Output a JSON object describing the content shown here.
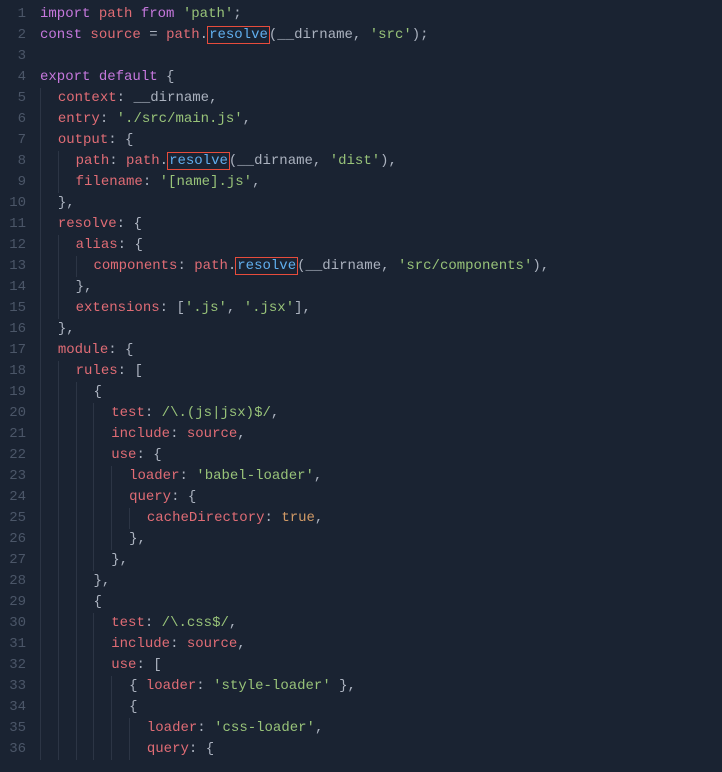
{
  "lines": [
    {
      "num": "1",
      "tokens": [
        [
          "kw",
          "import"
        ],
        [
          " "
        ],
        [
          "id",
          "path"
        ],
        [
          " "
        ],
        [
          "kw",
          "from"
        ],
        [
          " "
        ],
        [
          "str",
          "'path'"
        ],
        [
          "punc",
          ";"
        ]
      ]
    },
    {
      "num": "2",
      "tokens": [
        [
          "kw",
          "const"
        ],
        [
          " "
        ],
        [
          "id",
          "source"
        ],
        [
          " "
        ],
        [
          "punc",
          "="
        ],
        [
          " "
        ],
        [
          "id",
          "path"
        ],
        [
          "punc",
          "."
        ],
        [
          "fn hl",
          "resolve"
        ],
        [
          "punc",
          "("
        ],
        [
          "param",
          "__dirname"
        ],
        [
          "punc",
          ","
        ],
        [
          " "
        ],
        [
          "str",
          "'src'"
        ],
        [
          "punc",
          ");"
        ]
      ]
    },
    {
      "num": "3",
      "tokens": []
    },
    {
      "num": "4",
      "tokens": [
        [
          "kw",
          "export"
        ],
        [
          " "
        ],
        [
          "kw",
          "default"
        ],
        [
          " "
        ],
        [
          "punc",
          "{"
        ]
      ]
    },
    {
      "num": "5",
      "tokens": [
        [
          "",
          "  "
        ],
        [
          "prop",
          "context"
        ],
        [
          "punc",
          ":"
        ],
        [
          " "
        ],
        [
          "param",
          "__dirname"
        ],
        [
          "punc",
          ","
        ]
      ]
    },
    {
      "num": "6",
      "tokens": [
        [
          "",
          "  "
        ],
        [
          "prop",
          "entry"
        ],
        [
          "punc",
          ":"
        ],
        [
          " "
        ],
        [
          "str",
          "'./src/main.js'"
        ],
        [
          "punc",
          ","
        ]
      ]
    },
    {
      "num": "7",
      "tokens": [
        [
          "",
          "  "
        ],
        [
          "prop",
          "output"
        ],
        [
          "punc",
          ":"
        ],
        [
          " "
        ],
        [
          "punc",
          "{"
        ]
      ]
    },
    {
      "num": "8",
      "tokens": [
        [
          "",
          "    "
        ],
        [
          "prop",
          "path"
        ],
        [
          "punc",
          ":"
        ],
        [
          " "
        ],
        [
          "id",
          "path"
        ],
        [
          "punc",
          "."
        ],
        [
          "fn hl",
          "resolve"
        ],
        [
          "punc",
          "("
        ],
        [
          "param",
          "__dirname"
        ],
        [
          "punc",
          ","
        ],
        [
          " "
        ],
        [
          "str",
          "'dist'"
        ],
        [
          "punc",
          "),"
        ]
      ]
    },
    {
      "num": "9",
      "tokens": [
        [
          "",
          "    "
        ],
        [
          "prop",
          "filename"
        ],
        [
          "punc",
          ":"
        ],
        [
          " "
        ],
        [
          "str",
          "'[name].js'"
        ],
        [
          "punc",
          ","
        ]
      ]
    },
    {
      "num": "10",
      "tokens": [
        [
          "",
          "  "
        ],
        [
          "punc",
          "},"
        ]
      ]
    },
    {
      "num": "11",
      "tokens": [
        [
          "",
          "  "
        ],
        [
          "prop",
          "resolve"
        ],
        [
          "punc",
          ":"
        ],
        [
          " "
        ],
        [
          "punc",
          "{"
        ]
      ]
    },
    {
      "num": "12",
      "tokens": [
        [
          "",
          "    "
        ],
        [
          "prop",
          "alias"
        ],
        [
          "punc",
          ":"
        ],
        [
          " "
        ],
        [
          "punc",
          "{"
        ]
      ]
    },
    {
      "num": "13",
      "tokens": [
        [
          "",
          "      "
        ],
        [
          "prop",
          "components"
        ],
        [
          "punc",
          ":"
        ],
        [
          " "
        ],
        [
          "id",
          "path"
        ],
        [
          "punc",
          "."
        ],
        [
          "fn hl",
          "resolve"
        ],
        [
          "punc",
          "("
        ],
        [
          "param",
          "__dirname"
        ],
        [
          "punc",
          ","
        ],
        [
          " "
        ],
        [
          "str",
          "'src/components'"
        ],
        [
          "punc",
          "),"
        ]
      ]
    },
    {
      "num": "14",
      "tokens": [
        [
          "",
          "    "
        ],
        [
          "punc",
          "},"
        ]
      ]
    },
    {
      "num": "15",
      "tokens": [
        [
          "",
          "    "
        ],
        [
          "prop",
          "extensions"
        ],
        [
          "punc",
          ":"
        ],
        [
          " "
        ],
        [
          "punc",
          "["
        ],
        [
          "str",
          "'.js'"
        ],
        [
          "punc",
          ","
        ],
        [
          " "
        ],
        [
          "str",
          "'.jsx'"
        ],
        [
          "punc",
          "],"
        ]
      ]
    },
    {
      "num": "16",
      "tokens": [
        [
          "",
          "  "
        ],
        [
          "punc",
          "},"
        ]
      ]
    },
    {
      "num": "17",
      "tokens": [
        [
          "",
          "  "
        ],
        [
          "prop",
          "module"
        ],
        [
          "punc",
          ":"
        ],
        [
          " "
        ],
        [
          "punc",
          "{"
        ]
      ]
    },
    {
      "num": "18",
      "tokens": [
        [
          "",
          "    "
        ],
        [
          "prop",
          "rules"
        ],
        [
          "punc",
          ":"
        ],
        [
          " "
        ],
        [
          "punc",
          "["
        ]
      ]
    },
    {
      "num": "19",
      "tokens": [
        [
          "",
          "      "
        ],
        [
          "punc",
          "{"
        ]
      ]
    },
    {
      "num": "20",
      "tokens": [
        [
          "",
          "        "
        ],
        [
          "prop",
          "test"
        ],
        [
          "punc",
          ":"
        ],
        [
          " "
        ],
        [
          "regex",
          "/\\.(js|jsx)$/"
        ],
        [
          "punc",
          ","
        ]
      ]
    },
    {
      "num": "21",
      "tokens": [
        [
          "",
          "        "
        ],
        [
          "prop",
          "include"
        ],
        [
          "punc",
          ":"
        ],
        [
          " "
        ],
        [
          "id",
          "source"
        ],
        [
          "punc",
          ","
        ]
      ]
    },
    {
      "num": "22",
      "tokens": [
        [
          "",
          "        "
        ],
        [
          "prop",
          "use"
        ],
        [
          "punc",
          ":"
        ],
        [
          " "
        ],
        [
          "punc",
          "{"
        ]
      ]
    },
    {
      "num": "23",
      "tokens": [
        [
          "",
          "          "
        ],
        [
          "prop",
          "loader"
        ],
        [
          "punc",
          ":"
        ],
        [
          " "
        ],
        [
          "str",
          "'babel-loader'"
        ],
        [
          "punc",
          ","
        ]
      ]
    },
    {
      "num": "24",
      "tokens": [
        [
          "",
          "          "
        ],
        [
          "prop",
          "query"
        ],
        [
          "punc",
          ":"
        ],
        [
          " "
        ],
        [
          "punc",
          "{"
        ]
      ]
    },
    {
      "num": "25",
      "tokens": [
        [
          "",
          "            "
        ],
        [
          "prop",
          "cacheDirectory"
        ],
        [
          "punc",
          ":"
        ],
        [
          " "
        ],
        [
          "const",
          "true"
        ],
        [
          "punc",
          ","
        ]
      ]
    },
    {
      "num": "26",
      "tokens": [
        [
          "",
          "          "
        ],
        [
          "punc",
          "},"
        ]
      ]
    },
    {
      "num": "27",
      "tokens": [
        [
          "",
          "        "
        ],
        [
          "punc",
          "},"
        ]
      ]
    },
    {
      "num": "28",
      "tokens": [
        [
          "",
          "      "
        ],
        [
          "punc",
          "},"
        ]
      ]
    },
    {
      "num": "29",
      "tokens": [
        [
          "",
          "      "
        ],
        [
          "punc",
          "{"
        ]
      ]
    },
    {
      "num": "30",
      "tokens": [
        [
          "",
          "        "
        ],
        [
          "prop",
          "test"
        ],
        [
          "punc",
          ":"
        ],
        [
          " "
        ],
        [
          "regex",
          "/\\.css$/"
        ],
        [
          "punc",
          ","
        ]
      ]
    },
    {
      "num": "31",
      "tokens": [
        [
          "",
          "        "
        ],
        [
          "prop",
          "include"
        ],
        [
          "punc",
          ":"
        ],
        [
          " "
        ],
        [
          "id",
          "source"
        ],
        [
          "punc",
          ","
        ]
      ]
    },
    {
      "num": "32",
      "tokens": [
        [
          "",
          "        "
        ],
        [
          "prop",
          "use"
        ],
        [
          "punc",
          ":"
        ],
        [
          " "
        ],
        [
          "punc",
          "["
        ]
      ]
    },
    {
      "num": "33",
      "tokens": [
        [
          "",
          "          "
        ],
        [
          "punc",
          "{"
        ],
        [
          " "
        ],
        [
          "prop",
          "loader"
        ],
        [
          "punc",
          ":"
        ],
        [
          " "
        ],
        [
          "str",
          "'style-loader'"
        ],
        [
          " "
        ],
        [
          "punc",
          "},"
        ]
      ]
    },
    {
      "num": "34",
      "tokens": [
        [
          "",
          "          "
        ],
        [
          "punc",
          "{"
        ]
      ]
    },
    {
      "num": "35",
      "tokens": [
        [
          "",
          "            "
        ],
        [
          "prop",
          "loader"
        ],
        [
          "punc",
          ":"
        ],
        [
          " "
        ],
        [
          "str",
          "'css-loader'"
        ],
        [
          "punc",
          ","
        ]
      ]
    },
    {
      "num": "36",
      "tokens": [
        [
          "",
          "            "
        ],
        [
          "prop",
          "query"
        ],
        [
          "punc",
          ":"
        ],
        [
          " "
        ],
        [
          "punc",
          "{"
        ]
      ]
    }
  ]
}
